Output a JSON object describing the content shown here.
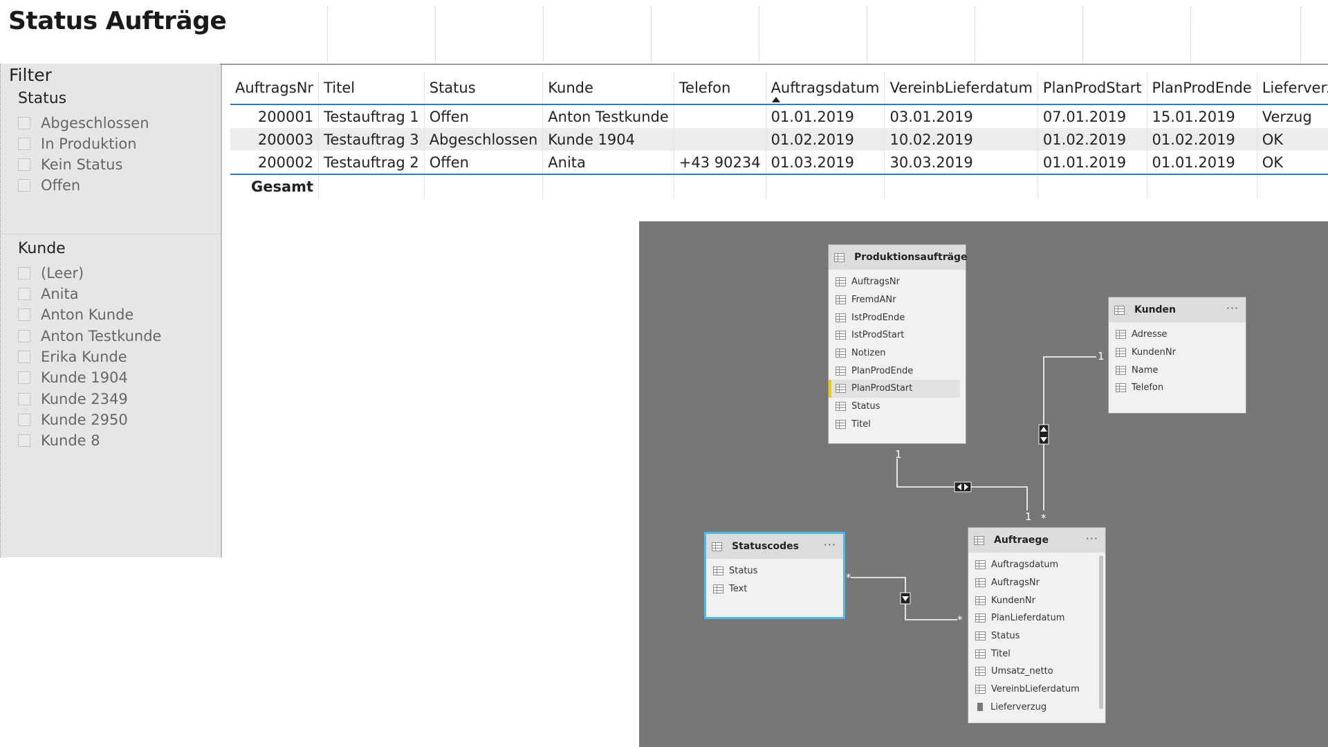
{
  "page": {
    "title": "Status Aufträge"
  },
  "filter": {
    "heading": "Filter",
    "status": {
      "title": "Status",
      "items": [
        "Abgeschlossen",
        "In Produktion",
        "Kein Status",
        "Offen"
      ]
    },
    "kunde": {
      "title": "Kunde",
      "items": [
        "(Leer)",
        "Anita",
        "Anton Kunde",
        "Anton Testkunde",
        "Erika Kunde",
        "Kunde 1904",
        "Kunde 2349",
        "Kunde 2950",
        "Kunde 8"
      ]
    }
  },
  "table": {
    "columns": [
      "AuftragsNr",
      "Titel",
      "Status",
      "Kunde",
      "Telefon",
      "Auftragsdatum",
      "VereinbLieferdatum",
      "PlanProdStart",
      "PlanProdEnde",
      "Lieferverzug"
    ],
    "rows": [
      [
        "200001",
        "Testauftrag 1",
        "Offen",
        "Anton Testkunde",
        "",
        "01.01.2019",
        "03.01.2019",
        "07.01.2019",
        "15.01.2019",
        "Verzug"
      ],
      [
        "200003",
        "Testauftrag 3",
        "Abgeschlossen",
        "Kunde 1904",
        "",
        "01.02.2019",
        "10.02.2019",
        "01.02.2019",
        "01.02.2019",
        "OK"
      ],
      [
        "200002",
        "Testauftrag 2",
        "Offen",
        "Anita",
        "+43 90234",
        "01.03.2019",
        "30.03.2019",
        "01.01.2019",
        "01.01.2019",
        "OK"
      ]
    ],
    "total_label": "Gesamt"
  },
  "diagram": {
    "tables": {
      "produktionsauftraege": {
        "name": "Produktionsaufträge",
        "fields": [
          "AuftragsNr",
          "FremdANr",
          "IstProdEnde",
          "IstProdStart",
          "Notizen",
          "PlanProdEnde",
          "PlanProdStart",
          "Status",
          "Titel"
        ]
      },
      "kunden": {
        "name": "Kunden",
        "fields": [
          "Adresse",
          "KundenNr",
          "Name",
          "Telefon"
        ]
      },
      "statuscodes": {
        "name": "Statuscodes",
        "fields": [
          "Status",
          "Text"
        ]
      },
      "auftraege": {
        "name": "Auftraege",
        "fields": [
          "Auftragsdatum",
          "AuftragsNr",
          "KundenNr",
          "PlanLieferdatum",
          "Status",
          "Titel",
          "Umsatz_netto",
          "VereinbLieferdatum",
          "Lieferverzug"
        ]
      }
    },
    "more_glyph": "···",
    "cardinality": {
      "one": "1",
      "many": "*"
    }
  },
  "colors": {
    "accent_line": "#2b7bbf",
    "diagram_bg": "#767676",
    "selected_border": "#4fb9e6",
    "highlight_field": "#f2c811"
  }
}
